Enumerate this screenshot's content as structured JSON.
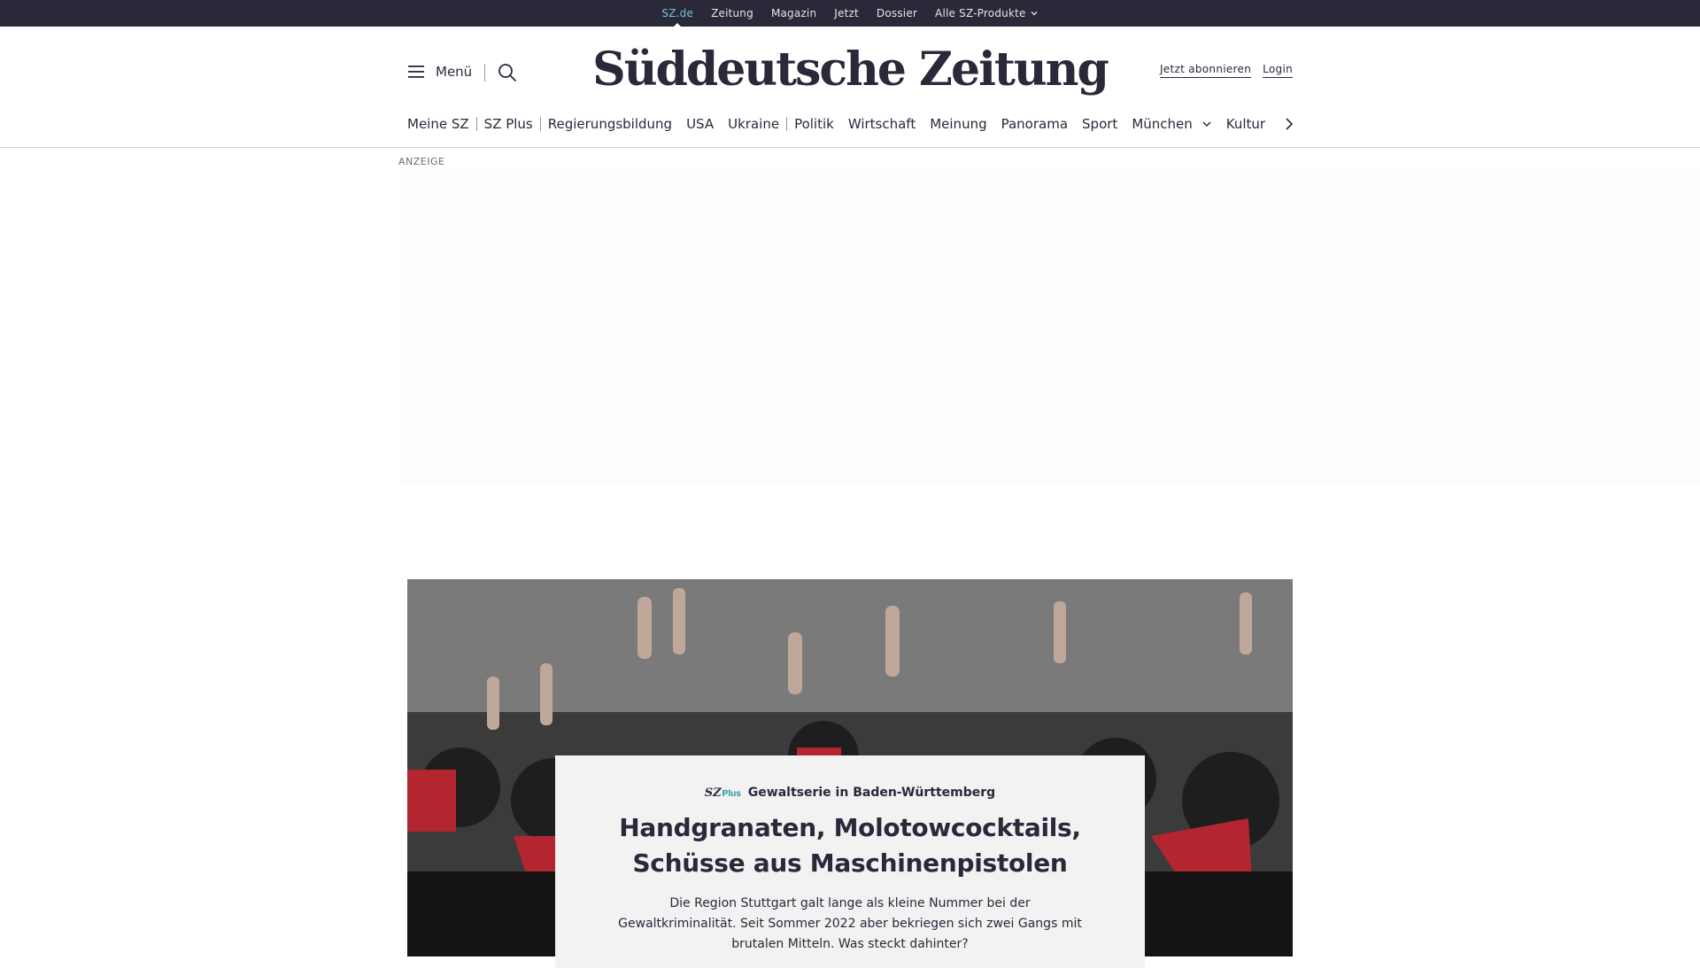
{
  "topbar": {
    "items": [
      {
        "label": "SZ.de"
      },
      {
        "label": "Zeitung"
      },
      {
        "label": "Magazin"
      },
      {
        "label": "Jetzt"
      },
      {
        "label": "Dossier"
      },
      {
        "label": "Alle SZ-Produkte"
      }
    ]
  },
  "header": {
    "menu_label": "Menü",
    "logo_text": "Süddeutsche Zeitung",
    "subscribe_label": "Jetzt abonnieren",
    "login_label": "Login"
  },
  "nav": {
    "items": [
      {
        "label": "Meine SZ"
      },
      {
        "label": "SZ Plus"
      },
      {
        "label": "Regierungsbildung"
      },
      {
        "label": "USA"
      },
      {
        "label": "Ukraine"
      },
      {
        "label": "Politik"
      },
      {
        "label": "Wirtschaft"
      },
      {
        "label": "Meinung"
      },
      {
        "label": "Panorama"
      },
      {
        "label": "Sport"
      },
      {
        "label": "München"
      },
      {
        "label": "Kultur"
      }
    ]
  },
  "ad": {
    "label": "ANZEIGE"
  },
  "teaser": {
    "badge_sz": "SZ",
    "badge_plus": "Plus",
    "kicker": "Gewaltserie in Baden-Württemberg",
    "headline": "Handgranaten, Molotowcocktails, Schüsse aus Maschinenpistolen",
    "text": "Die Region Stuttgart galt lange als kleine Nummer bei der Gewaltkriminalität. Seit Sommer 2022 aber bekriegen sich zwei Gangs mit brutalen Mitteln. Was steckt dahinter?"
  },
  "icons": {
    "menu": "hamburger-icon",
    "search": "search-icon",
    "dropdown": "chevron-down-icon",
    "next": "chevron-right-icon"
  },
  "colors": {
    "topbar_bg": "#29293a",
    "active_link": "#71c5d6",
    "text": "#29293a",
    "plus_accent": "#1a8fa0",
    "teaser_bg": "#f2f2f2"
  }
}
